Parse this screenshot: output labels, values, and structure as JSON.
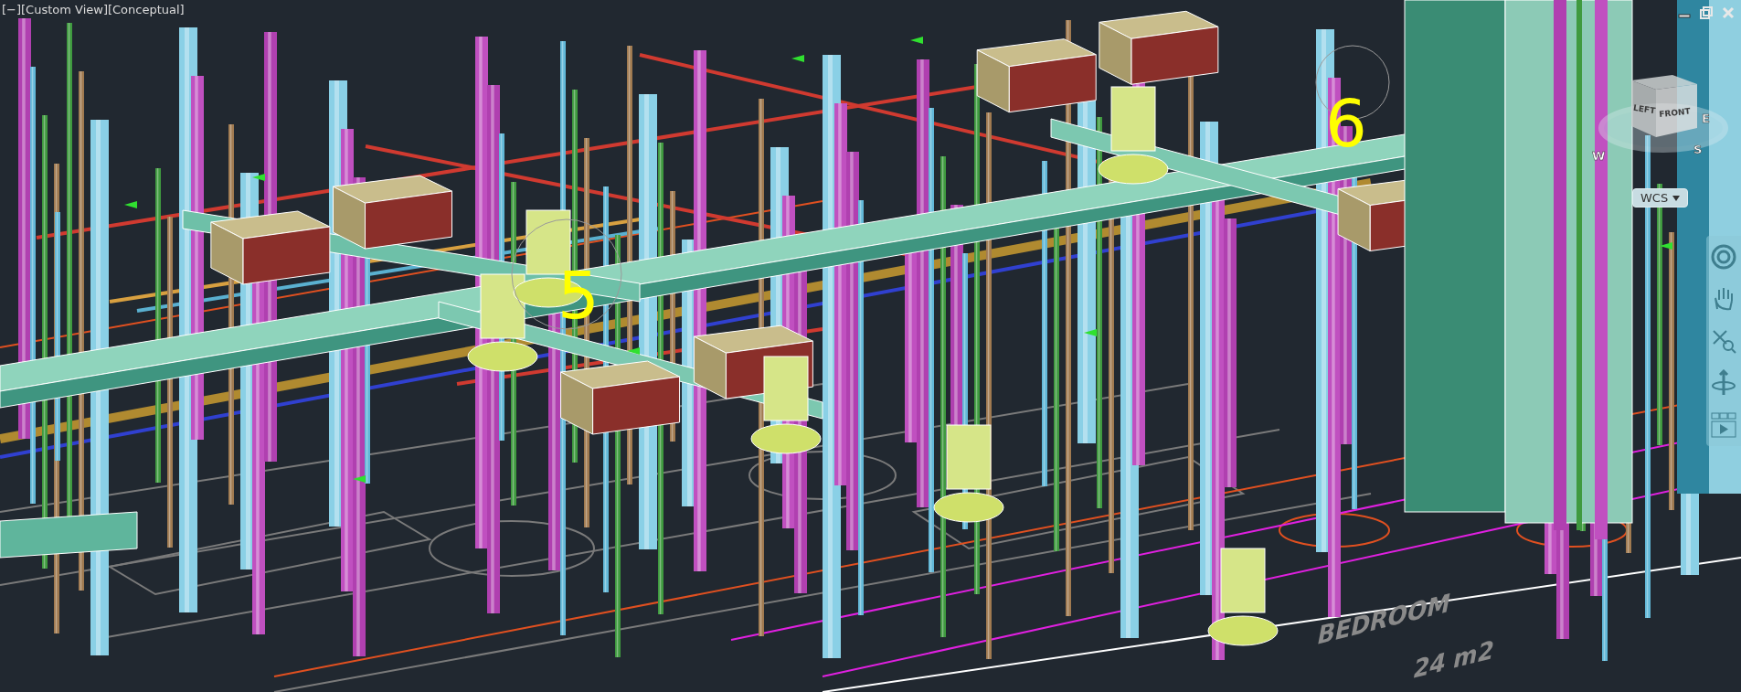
{
  "viewport": {
    "label": "[−][Custom View][Conceptual]"
  },
  "callouts": [
    {
      "text": "5"
    },
    {
      "text": "6"
    }
  ],
  "viewcube": {
    "faces": [
      "LEFT",
      "FRONT"
    ],
    "compass": [
      "W",
      "E",
      "S"
    ]
  },
  "wcs": {
    "label": "WCS"
  },
  "floor_labels": [
    "BEDROOM",
    "24 m2"
  ]
}
